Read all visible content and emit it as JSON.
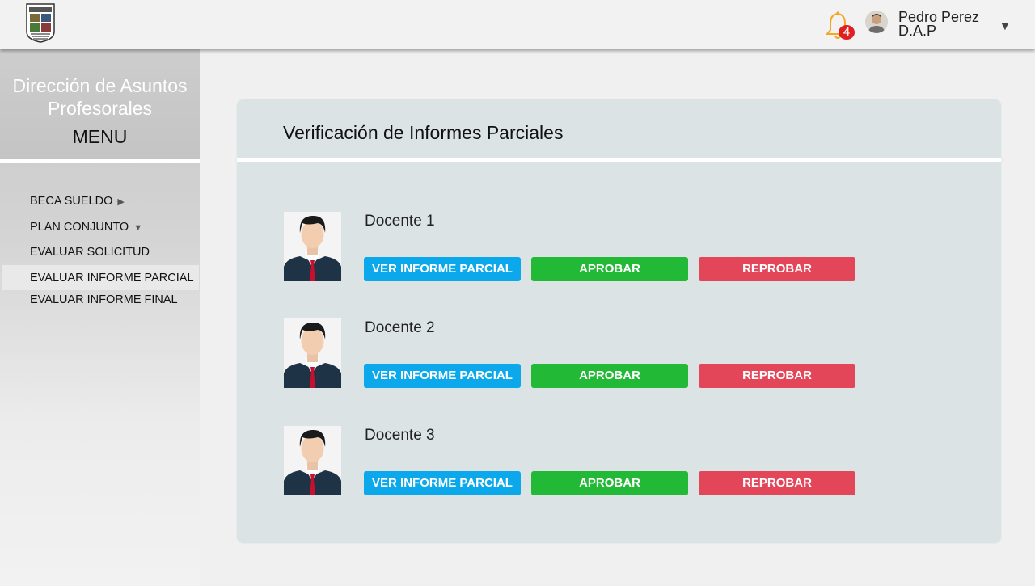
{
  "header": {
    "notifications_count": "4",
    "user_name": "Pedro Perez",
    "user_role": "D.A.P",
    "icons": {
      "logo": "institution-crest",
      "bell": "bell-icon",
      "caret": "chevron-down-icon"
    }
  },
  "sidebar": {
    "title_line1": "Dirección de Asuntos",
    "title_line2": "Profesorales",
    "menu_label": "MENU",
    "items": [
      {
        "label": "BECA SUELDO",
        "arrow": "▶"
      },
      {
        "label": "PLAN CONJUNTO",
        "arrow": "▼"
      },
      {
        "label": "EVALUAR SOLICITUD"
      },
      {
        "label": "EVALUAR INFORME PARCIAL",
        "active": true
      },
      {
        "label": "EVALUAR INFORME FINAL"
      }
    ]
  },
  "main": {
    "title": "Verificación de Informes Parciales",
    "teachers": [
      {
        "name": "Docente 1"
      },
      {
        "name": "Docente 2"
      },
      {
        "name": "Docente 3"
      }
    ],
    "buttons": {
      "view": "VER INFORME PARCIAL",
      "approve": "APROBAR",
      "reject": "REPROBAR"
    }
  },
  "colors": {
    "view": "#0ba9ec",
    "approve": "#22b936",
    "reject": "#e34659",
    "badge": "#e02020",
    "bell": "#f5a623"
  }
}
